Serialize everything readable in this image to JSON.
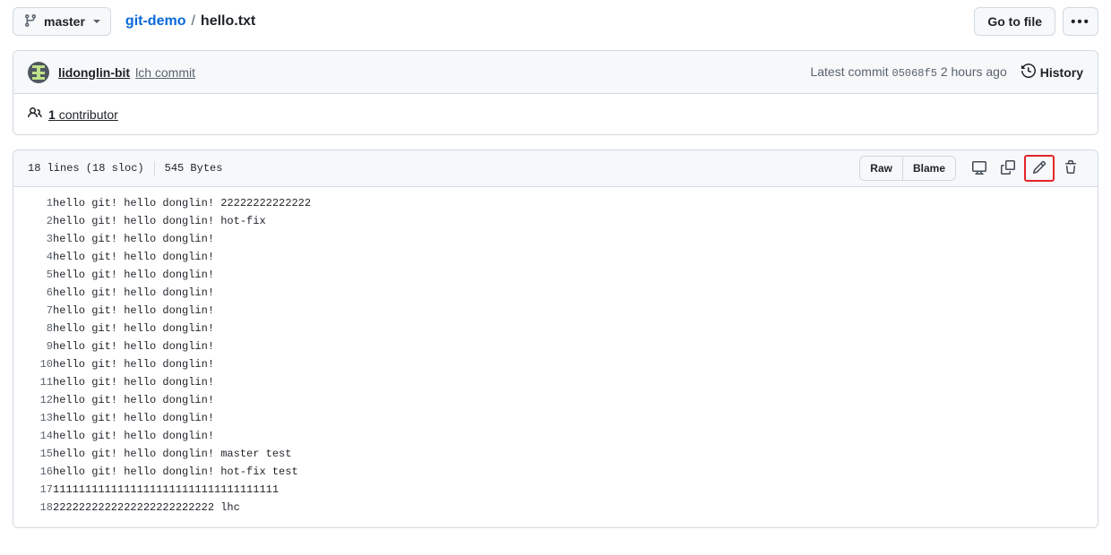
{
  "topbar": {
    "branch": {
      "label": "master",
      "icon": "git-branch-icon",
      "caret": "chevron-down-icon"
    },
    "breadcrumb": {
      "repo": "git-demo",
      "separator": "/",
      "filename": "hello.txt"
    },
    "go_to_file": "Go to file",
    "kebab": "•••"
  },
  "commit": {
    "author": "lidonglin-bit",
    "message": "lch commit",
    "latest_label": "Latest commit",
    "sha": "05068f5",
    "time": "2 hours ago",
    "history_label": "History",
    "history_icon": "history-clock-icon",
    "avatar": "user-avatar"
  },
  "contributors": {
    "icon": "people-icon",
    "count": "1",
    "label": "contributor"
  },
  "file": {
    "lines_label": "18 lines (18 sloc)",
    "size_label": "545 Bytes",
    "actions": {
      "raw": "Raw",
      "blame": "Blame",
      "open_desktop_icon": "desktop-download-icon",
      "copy_icon": "copy-icon",
      "edit_icon": "pencil-edit-icon",
      "delete_icon": "trash-delete-icon"
    },
    "highlight_color": "#e5252a"
  },
  "code_lines": [
    {
      "n": "1",
      "text": "hello git! hello donglin! 22222222222222"
    },
    {
      "n": "2",
      "text": "hello git! hello donglin! hot-fix"
    },
    {
      "n": "3",
      "text": "hello git! hello donglin!"
    },
    {
      "n": "4",
      "text": "hello git! hello donglin!"
    },
    {
      "n": "5",
      "text": "hello git! hello donglin!"
    },
    {
      "n": "6",
      "text": "hello git! hello donglin!"
    },
    {
      "n": "7",
      "text": "hello git! hello donglin!"
    },
    {
      "n": "8",
      "text": "hello git! hello donglin!"
    },
    {
      "n": "9",
      "text": "hello git! hello donglin!"
    },
    {
      "n": "10",
      "text": "hello git! hello donglin!"
    },
    {
      "n": "11",
      "text": "hello git! hello donglin!"
    },
    {
      "n": "12",
      "text": "hello git! hello donglin!"
    },
    {
      "n": "13",
      "text": "hello git! hello donglin!"
    },
    {
      "n": "14",
      "text": "hello git! hello donglin!"
    },
    {
      "n": "15",
      "text": "hello git! hello donglin! master test"
    },
    {
      "n": "16",
      "text": "hello git! hello donglin! hot-fix test"
    },
    {
      "n": "17",
      "text": "11111111111111111111111111111111111"
    },
    {
      "n": "18",
      "text": "2222222222222222222222222 lhc"
    }
  ]
}
